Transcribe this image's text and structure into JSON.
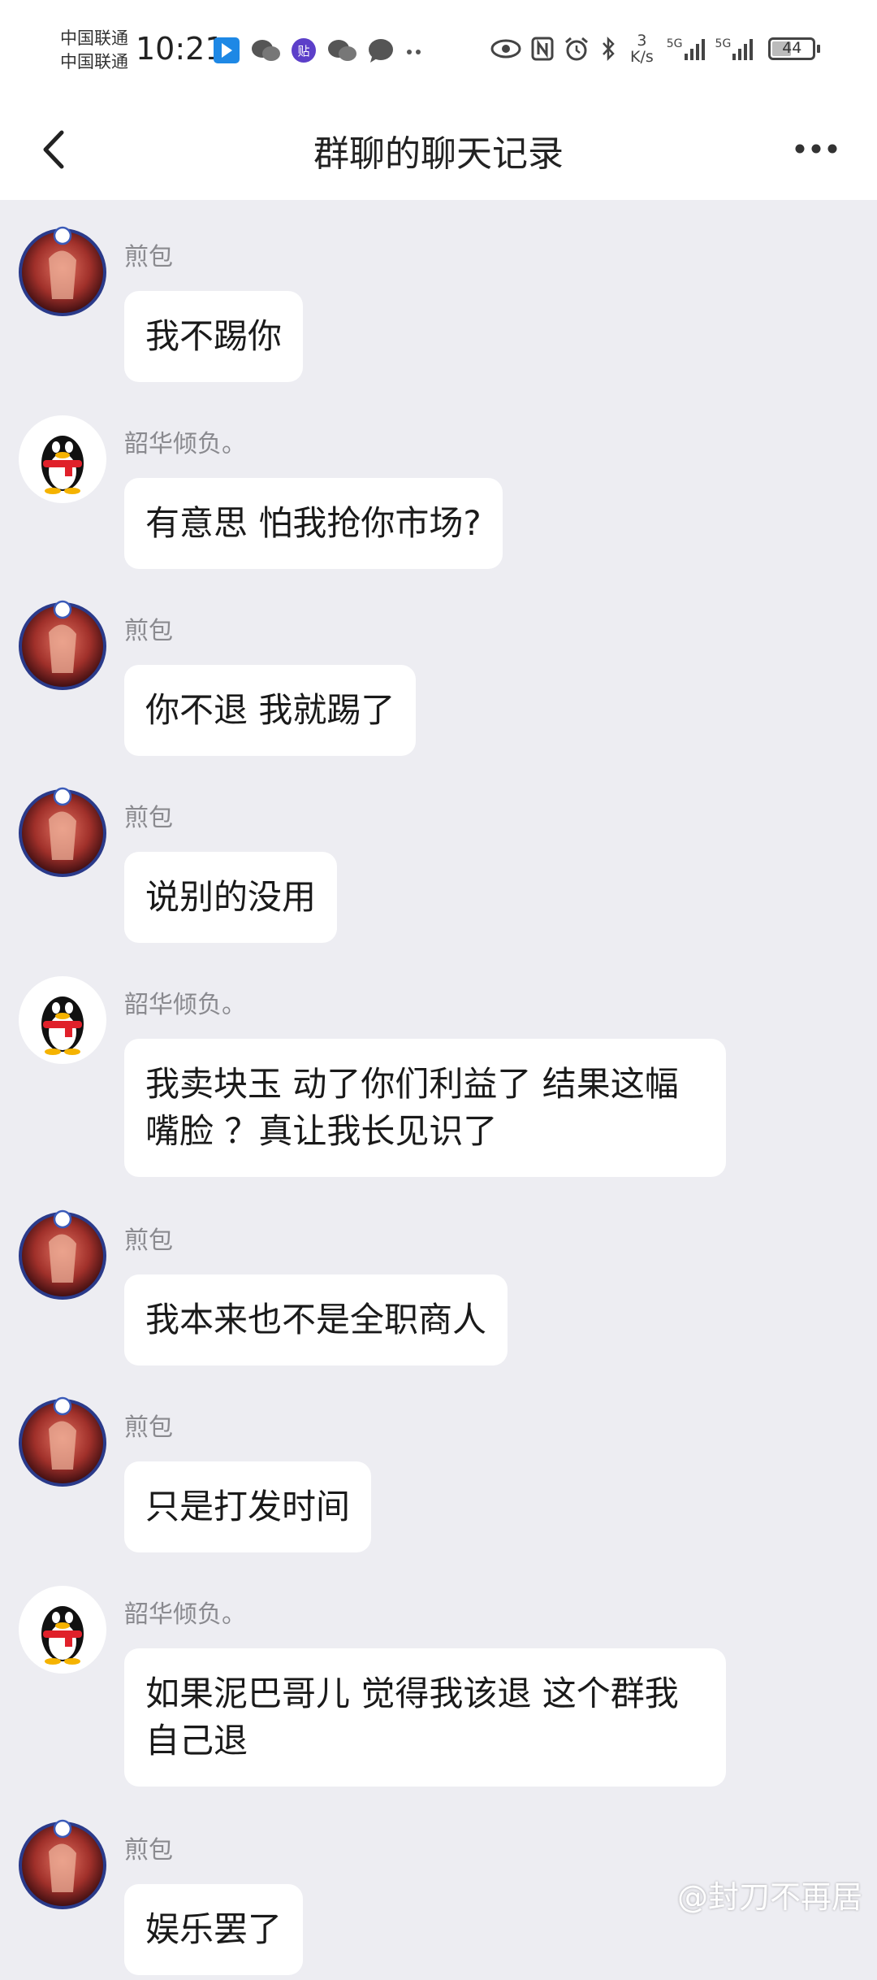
{
  "status_bar": {
    "carrier1": "中国联通",
    "carrier2": "中国联通",
    "time": "10:21",
    "speed_value": "3",
    "speed_unit": "K/s",
    "signal1": "5G",
    "signal2": "5G",
    "battery": "44"
  },
  "header": {
    "title": "群聊的聊天记录"
  },
  "messages": [
    {
      "sender": "煎包",
      "text": "我不踢你",
      "avatar": "anime-avatar"
    },
    {
      "sender": "韶华倾负。",
      "text": "有意思  怕我抢你市场?",
      "avatar": "penguin-avatar"
    },
    {
      "sender": "煎包",
      "text": "你不退 我就踢了",
      "avatar": "anime-avatar"
    },
    {
      "sender": "煎包",
      "text": "说别的没用",
      "avatar": "anime-avatar"
    },
    {
      "sender": "韶华倾负。",
      "text": "我卖块玉  动了你们利益了   结果这幅嘴脸  ？真让我长见识了",
      "avatar": "penguin-avatar"
    },
    {
      "sender": "煎包",
      "text": "我本来也不是全职商人",
      "avatar": "anime-avatar"
    },
    {
      "sender": "煎包",
      "text": "只是打发时间",
      "avatar": "anime-avatar"
    },
    {
      "sender": "韶华倾负。",
      "text": "如果泥巴哥儿 觉得我该退  这个群我自己退",
      "avatar": "penguin-avatar"
    },
    {
      "sender": "煎包",
      "text": "娱乐罢了",
      "avatar": "anime-avatar"
    }
  ],
  "watermark": "@封刀不再居",
  "colors": {
    "background": "#ededf2",
    "bubble": "#ffffff",
    "sender_text": "#8a8a8f"
  }
}
